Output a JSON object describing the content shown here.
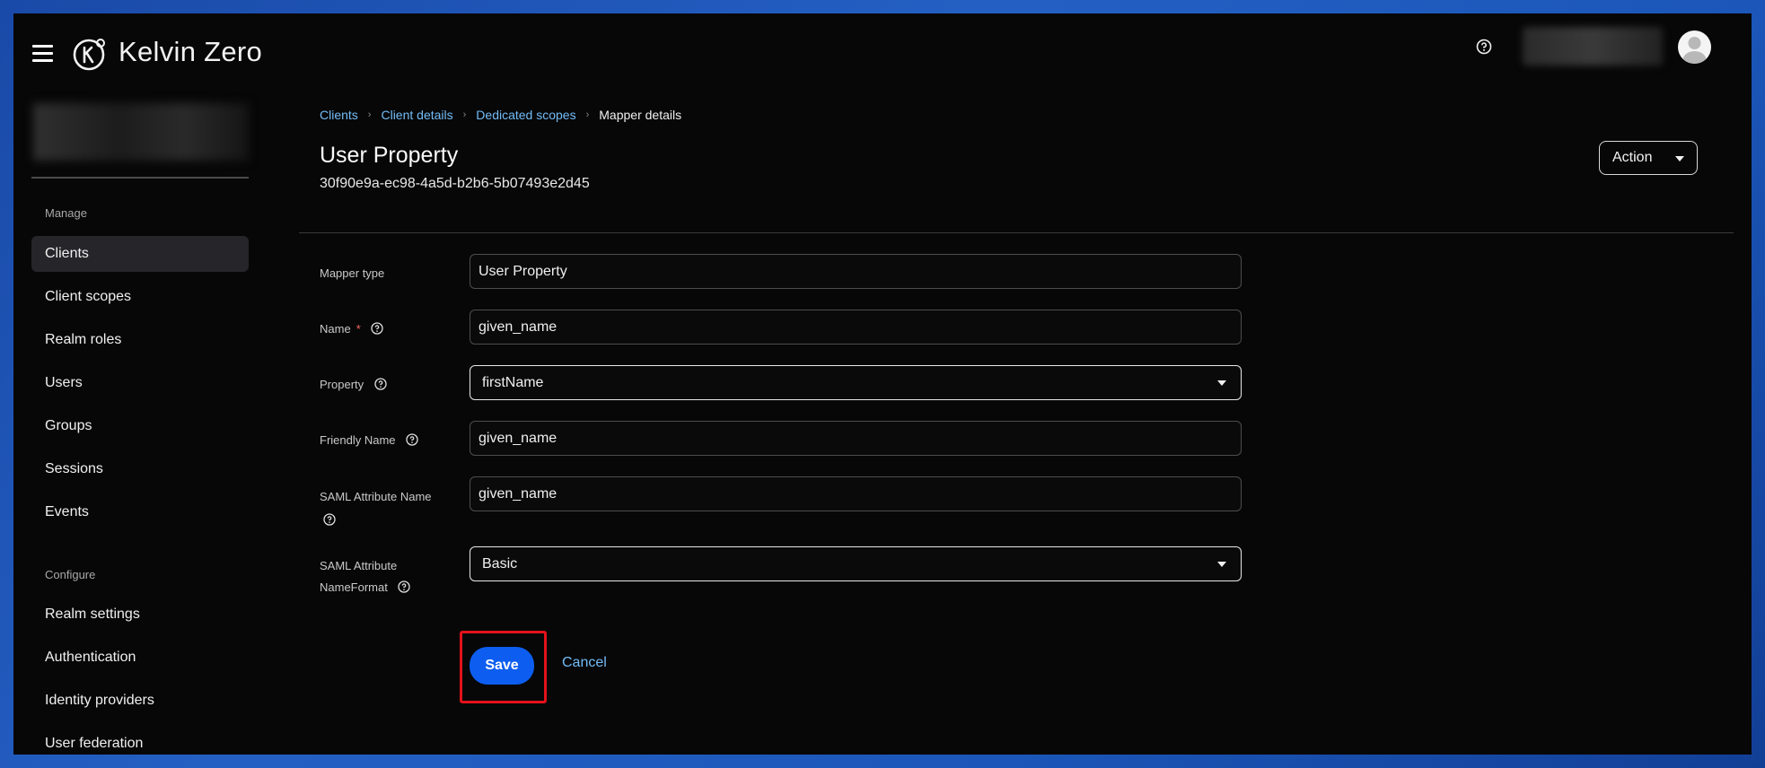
{
  "app": {
    "brand": "Kelvin Zero"
  },
  "header": {
    "help_icon": "help-circle-icon",
    "user_icon": "user-avatar-icon"
  },
  "sidebar": {
    "manage_heading": "Manage",
    "manage_items": [
      {
        "label": "Clients",
        "active": true
      },
      {
        "label": "Client scopes"
      },
      {
        "label": "Realm roles"
      },
      {
        "label": "Users"
      },
      {
        "label": "Groups"
      },
      {
        "label": "Sessions"
      },
      {
        "label": "Events"
      }
    ],
    "configure_heading": "Configure",
    "configure_items": [
      {
        "label": "Realm settings"
      },
      {
        "label": "Authentication"
      },
      {
        "label": "Identity providers"
      },
      {
        "label": "User federation"
      }
    ]
  },
  "breadcrumb": {
    "items": [
      "Clients",
      "Client details",
      "Dedicated scopes"
    ],
    "current": "Mapper details"
  },
  "page": {
    "title": "User Property",
    "id": "30f90e9a-ec98-4a5d-b2b6-5b07493e2d45",
    "action_label": "Action"
  },
  "form": {
    "mapper_type": {
      "label": "Mapper type",
      "value": "User Property"
    },
    "name": {
      "label": "Name",
      "required_mark": "*",
      "value": "given_name"
    },
    "property": {
      "label": "Property",
      "value": "firstName"
    },
    "friendly_name": {
      "label": "Friendly Name",
      "value": "given_name"
    },
    "saml_attribute_name": {
      "label_line1": "SAML Attribute Name",
      "value": "given_name"
    },
    "saml_name_format": {
      "label_line1": "SAML Attribute",
      "label_line2": "NameFormat",
      "value": "Basic"
    }
  },
  "buttons": {
    "save": "Save",
    "cancel": "Cancel"
  },
  "colors": {
    "accent": "#0d5ef0",
    "link": "#73bcf7",
    "highlight": "#e3121a",
    "background": "#070707"
  }
}
